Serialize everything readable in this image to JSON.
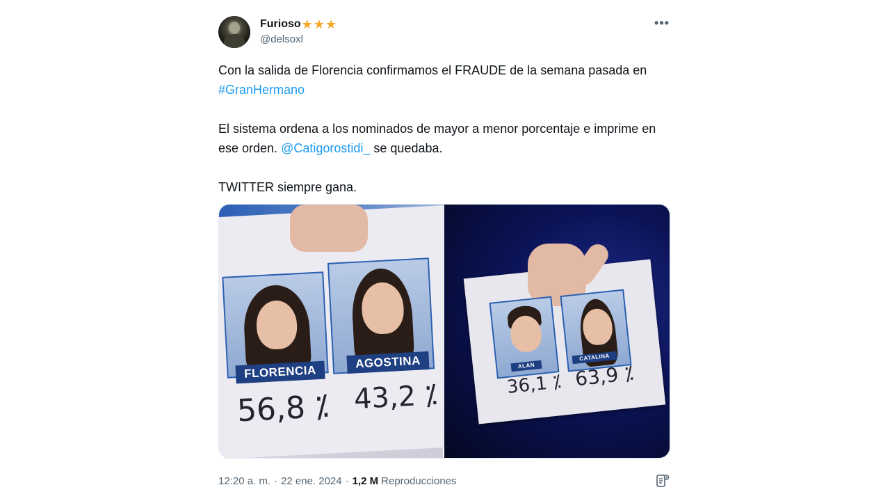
{
  "author": {
    "display_name": "Furioso",
    "badges": [
      "★",
      "★",
      "★"
    ],
    "handle": "@delsoxl",
    "avatar_icon": "avatar-photo"
  },
  "more_label": "•••",
  "text": {
    "p1_before": "Con la salida de Florencia confirmamos el FRAUDE de la semana pasada en ",
    "p1_hashtag": "#GranHermano",
    "p2_before": "El sistema ordena a los nominados de mayor a menor porcentaje e imprime en ese orden. ",
    "p2_mention": "@Catigorostidi_",
    "p2_after": " se quedaba.",
    "p3": "TWITTER siempre gana."
  },
  "media": {
    "left": {
      "names": [
        "FLORENCIA",
        "AGOSTINA"
      ],
      "percentages": [
        "56,8 ⁒",
        "43,2 ⁒"
      ]
    },
    "right": {
      "names": [
        "ALAN",
        "CATALINA"
      ],
      "percentages": [
        "36,1 ⁒",
        "63,9 ⁒"
      ]
    }
  },
  "footer": {
    "time": "12:20 a. m.",
    "separator": "·",
    "date": "22 ene. 2024",
    "views_count": "1,2 M",
    "views_label": "Reproducciones"
  },
  "colors": {
    "link": "#1d9bf0",
    "secondary": "#536471",
    "star": "#f5a623"
  }
}
